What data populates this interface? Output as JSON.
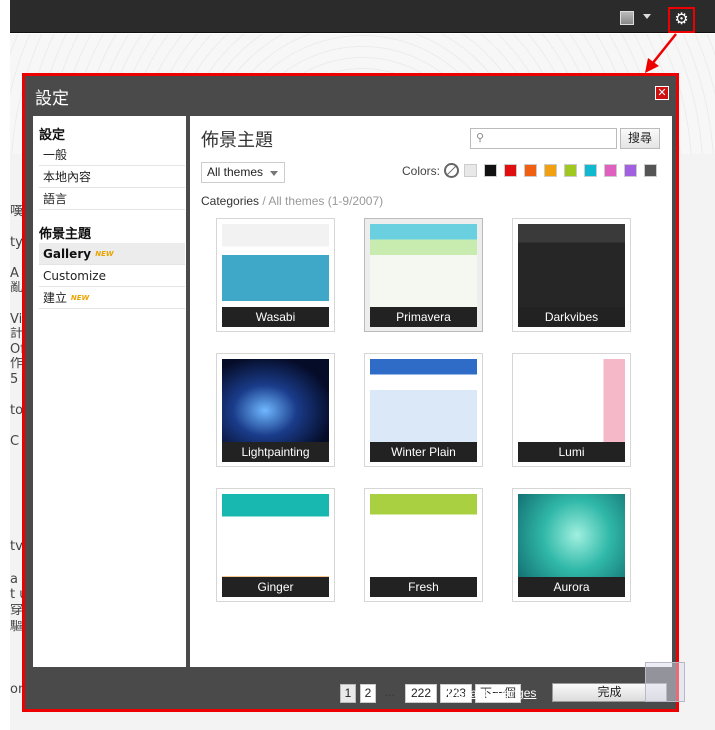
{
  "dialog": {
    "title": "設定",
    "close_label": "✕"
  },
  "topbar": {
    "gear_icon": "⚙"
  },
  "sidebar": {
    "settings_heading": "設定",
    "settings_items": [
      "一般",
      "本地內容",
      "語言"
    ],
    "themes_heading": "佈景主題",
    "theme_items": [
      {
        "label": "Gallery",
        "badge": "NEW"
      },
      {
        "label": "Customize",
        "badge": ""
      },
      {
        "label": "建立",
        "badge": "NEW"
      }
    ]
  },
  "content": {
    "title": "佈景主題",
    "search": {
      "placeholder": "",
      "button": "搜尋"
    },
    "filter": {
      "selected": "All themes"
    },
    "colors_label": "Colors:",
    "colors": [
      "#e8e8e8",
      "#111111",
      "#e01010",
      "#f06010",
      "#f0a010",
      "#a0c820",
      "#10b8d0",
      "#e060c0",
      "#a060e0",
      "#555555"
    ],
    "breadcrumb": {
      "root": "Categories",
      "separator": "/",
      "current": "All themes (1-9/2007)"
    },
    "themes": [
      {
        "name": "Wasabi"
      },
      {
        "name": "Primavera"
      },
      {
        "name": "Darkvibes"
      },
      {
        "name": "Lightpainting"
      },
      {
        "name": "Winter Plain"
      },
      {
        "name": "Lumi"
      },
      {
        "name": "Ginger"
      },
      {
        "name": "Fresh"
      },
      {
        "name": "Aurora"
      }
    ],
    "pager": {
      "p1": "1",
      "p2": "2",
      "ellipsis": "...",
      "p222": "222",
      "p223": "223",
      "next": "下一個"
    }
  },
  "footer": {
    "discard": "Discard changes",
    "done": "完成"
  },
  "background_text": [
    "嘆",
    "ty",
    "A",
    "亂",
    "Vir",
    "計",
    "Of",
    "作",
    "5 ",
    "to",
    "C",
    "tv",
    "a",
    "t u",
    "穿",
    "驅",
    "ont"
  ]
}
